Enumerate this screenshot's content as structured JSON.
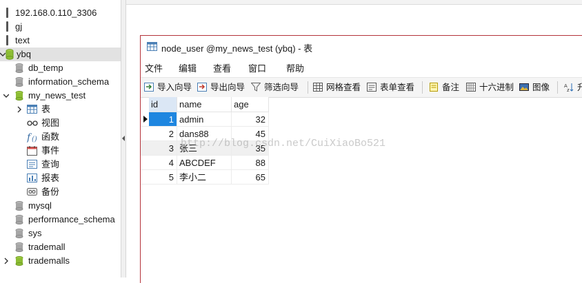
{
  "tree": {
    "server": "192.168.0.110_3306",
    "databases_top": [
      "gj",
      "text"
    ],
    "selected_db": "ybq",
    "children": [
      "db_temp",
      "information_schema"
    ],
    "open_db": "my_news_test",
    "objects": [
      "表",
      "视图",
      "函数",
      "事件",
      "查询",
      "报表",
      "备份"
    ],
    "others": [
      "mysql",
      "performance_schema",
      "sys",
      "trademall",
      "trademalls"
    ]
  },
  "window": {
    "title": "node_user @my_news_test (ybq) - 表",
    "menu": [
      "文件",
      "编辑",
      "查看",
      "窗口",
      "帮助"
    ],
    "toolbar": [
      "导入向导",
      "导出向导",
      "筛选向导",
      "网格查看",
      "表单查看",
      "备注",
      "十六进制",
      "图像",
      "升"
    ]
  },
  "grid": {
    "columns": [
      "id",
      "name",
      "age"
    ],
    "rows": [
      {
        "id": "1",
        "name": "admin",
        "age": "32"
      },
      {
        "id": "2",
        "name": "dans88",
        "age": "45"
      },
      {
        "id": "3",
        "name": "张三",
        "age": "35"
      },
      {
        "id": "4",
        "name": "ABCDEF",
        "age": "88"
      },
      {
        "id": "5",
        "name": "李小二",
        "age": "65"
      }
    ]
  },
  "watermark": "http://blog.csdn.net/CuiXiaoBo521",
  "colors": {
    "selection": "#1e86e0",
    "db_green": "#8dbd35",
    "db_gray": "#9a9a9a",
    "window_border": "#b4323a"
  }
}
